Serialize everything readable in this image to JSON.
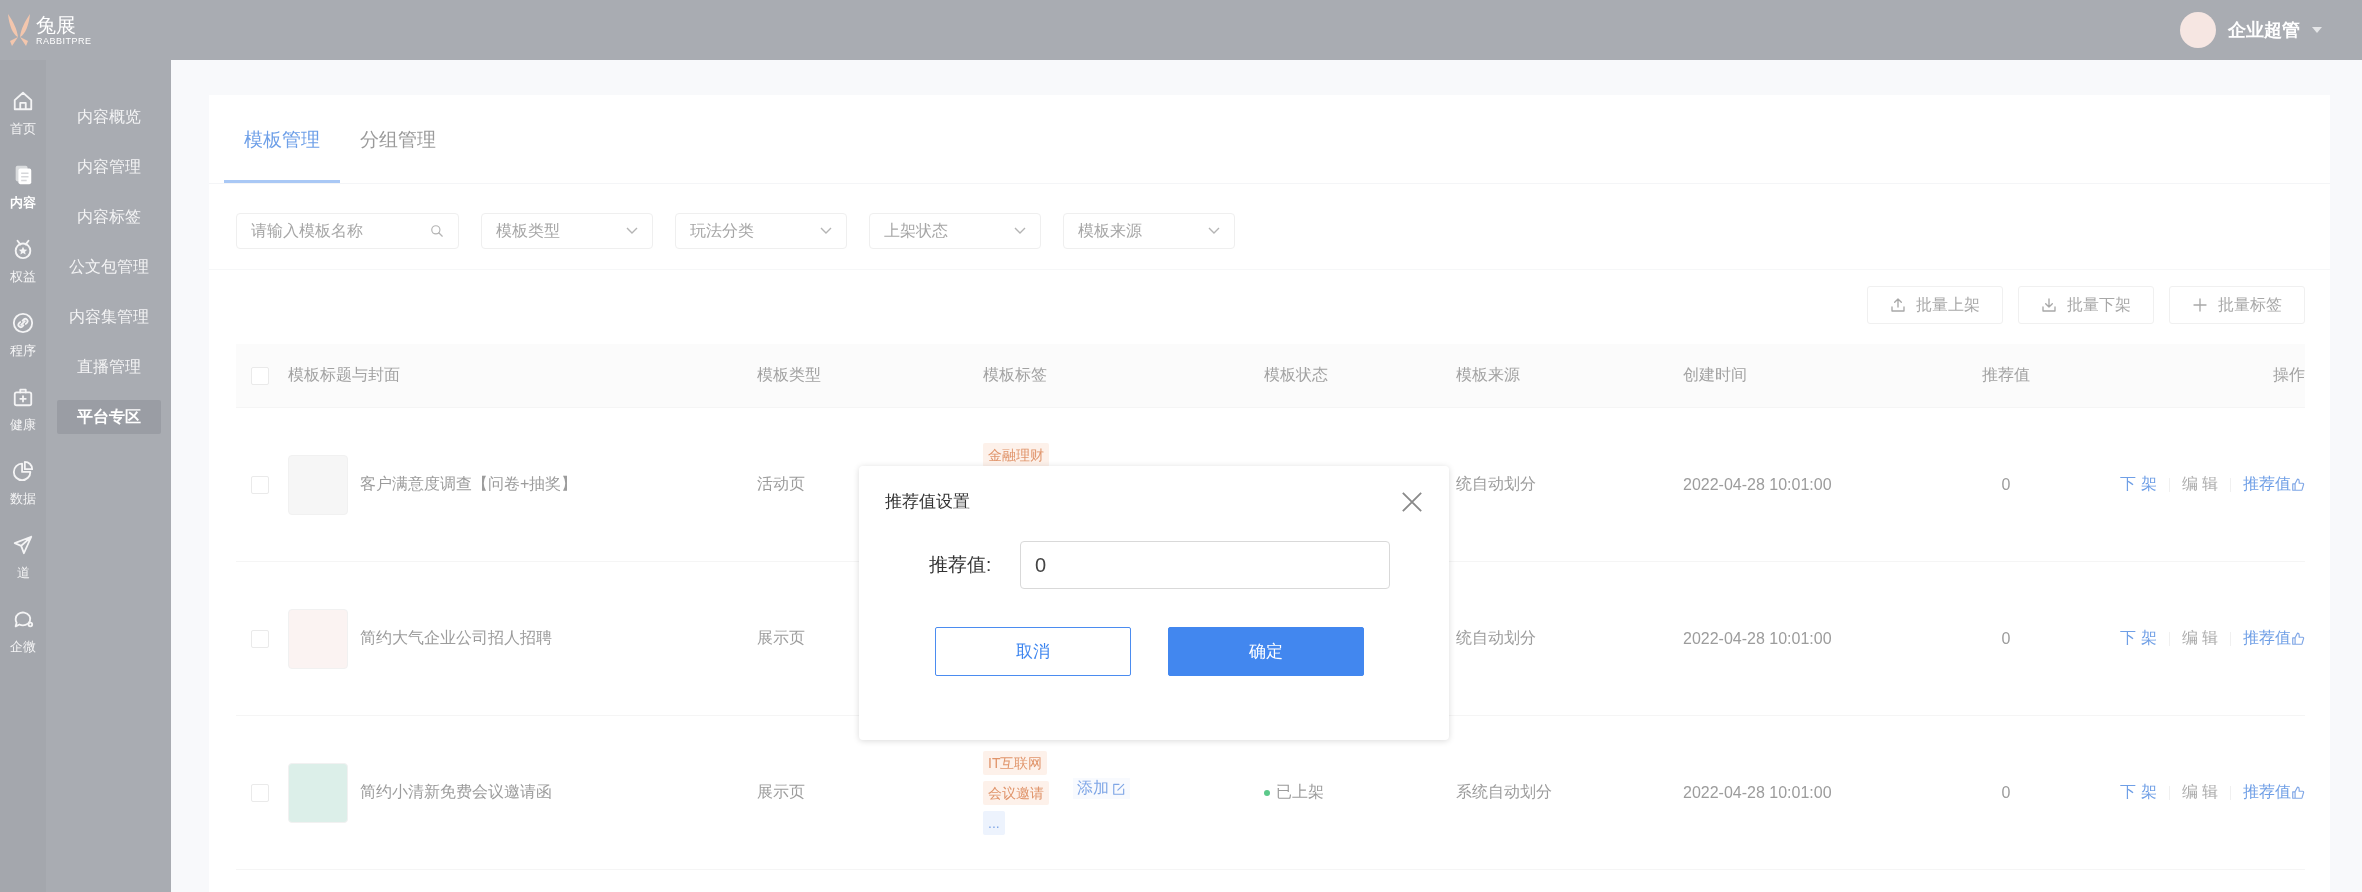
{
  "header": {
    "logo_text": "兔展",
    "logo_subtext": "RABBITPRE",
    "user_name": "企业超管"
  },
  "nav_rail": [
    {
      "kind": "home",
      "label": "首页",
      "selected": false
    },
    {
      "kind": "document",
      "label": "内容",
      "selected": true
    },
    {
      "kind": "medal",
      "label": "权益",
      "selected": false
    },
    {
      "kind": "link",
      "label": "程序",
      "selected": false
    },
    {
      "kind": "medkit",
      "label": "健康",
      "selected": false
    },
    {
      "kind": "pie",
      "label": "数据",
      "selected": false
    },
    {
      "kind": "plane",
      "label": "道",
      "selected": false
    },
    {
      "kind": "chat",
      "label": "企微",
      "selected": false
    }
  ],
  "submenu": [
    {
      "label": "内容概览",
      "selected": false
    },
    {
      "label": "内容管理",
      "selected": false
    },
    {
      "label": "内容标签",
      "selected": false
    },
    {
      "label": "公文包管理",
      "selected": false
    },
    {
      "label": "内容集管理",
      "selected": false
    },
    {
      "label": "直播管理",
      "selected": false
    },
    {
      "label": "平台专区",
      "selected": true
    }
  ],
  "tabs": [
    {
      "label": "模板管理",
      "selected": true
    },
    {
      "label": "分组管理",
      "selected": false
    }
  ],
  "filters": [
    {
      "kind": "search",
      "placeholder": "请输入模板名称"
    },
    {
      "kind": "select",
      "placeholder": "模板类型"
    },
    {
      "kind": "select",
      "placeholder": "玩法分类"
    },
    {
      "kind": "select",
      "placeholder": "上架状态"
    },
    {
      "kind": "select",
      "placeholder": "模板来源"
    }
  ],
  "batch_buttons": [
    {
      "kind": "upload",
      "label": "批量上架"
    },
    {
      "kind": "download",
      "label": "批量下架"
    },
    {
      "kind": "plus",
      "label": "批量标签"
    }
  ],
  "table": {
    "columns": [
      "模板标题与封面",
      "模板类型",
      "模板标签",
      "模板状态",
      "模板来源",
      "创建时间",
      "推荐值",
      "操作"
    ],
    "header_checked": false,
    "rows": [
      {
        "checked": false,
        "title": "客户满意度调查【问卷+抽奖】",
        "type": "活动页",
        "tags": [
          {
            "kind": "tag",
            "label": "金融理财"
          }
        ],
        "source": "统自动划分",
        "created": "2022-04-28 10:01:00",
        "score": "0",
        "actions": [
          {
            "kind": "link",
            "label": "下 架"
          },
          {
            "kind": "disabled",
            "label": "编 辑"
          },
          {
            "kind": "recommend",
            "label": "推荐值"
          }
        ]
      },
      {
        "checked": false,
        "title": "简约大气企业公司招人招聘",
        "type": "展示页",
        "tags": [],
        "source": "统自动划分",
        "created": "2022-04-28 10:01:00",
        "score": "0",
        "actions": [
          {
            "kind": "link",
            "label": "下 架"
          },
          {
            "kind": "disabled",
            "label": "编 辑"
          },
          {
            "kind": "recommend",
            "label": "推荐值"
          }
        ]
      },
      {
        "checked": false,
        "title": "简约小清新免费会议邀请函",
        "type": "展示页",
        "tags": [
          {
            "kind": "tag",
            "label": "IT互联网"
          },
          {
            "kind": "tag",
            "label": "会议邀请"
          },
          {
            "kind": "more",
            "label": "..."
          }
        ],
        "add_tag": "添加",
        "status": {
          "label": "已上架",
          "published": true
        },
        "source": "系统自动划分",
        "created": "2022-04-28 10:01:00",
        "score": "0",
        "actions": [
          {
            "kind": "link",
            "label": "下 架"
          },
          {
            "kind": "disabled",
            "label": "编 辑"
          },
          {
            "kind": "recommend",
            "label": "推荐值"
          }
        ]
      }
    ]
  },
  "dialog": {
    "title": "推荐值设置",
    "field_label": "推荐值:",
    "value": "0",
    "buttons": [
      {
        "kind": "secondary",
        "label": "取消"
      },
      {
        "kind": "primary",
        "label": "确定"
      }
    ]
  }
}
